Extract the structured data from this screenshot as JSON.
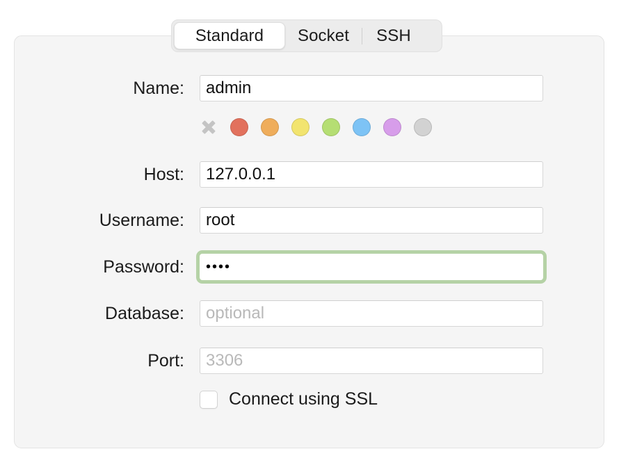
{
  "tabs": [
    {
      "id": "standard",
      "label": "Standard",
      "selected": true
    },
    {
      "id": "socket",
      "label": "Socket",
      "selected": false
    },
    {
      "id": "ssh",
      "label": "SSH",
      "selected": false
    }
  ],
  "form": {
    "name": {
      "label": "Name:",
      "value": "admin",
      "placeholder": ""
    },
    "host": {
      "label": "Host:",
      "value": "127.0.0.1",
      "placeholder": ""
    },
    "username": {
      "label": "Username:",
      "value": "root",
      "placeholder": ""
    },
    "password": {
      "label": "Password:",
      "value": "••••",
      "masked_character_count": 4,
      "placeholder": "",
      "focused": true
    },
    "database": {
      "label": "Database:",
      "value": "",
      "placeholder": "optional"
    },
    "port": {
      "label": "Port:",
      "value": "",
      "placeholder": "3306"
    }
  },
  "color_swatches": {
    "clear_icon": "x-icon",
    "items": [
      {
        "name": "red",
        "hex": "#e2715d"
      },
      {
        "name": "orange",
        "hex": "#efad5b"
      },
      {
        "name": "yellow",
        "hex": "#f2e46f"
      },
      {
        "name": "green",
        "hex": "#b5de73"
      },
      {
        "name": "blue",
        "hex": "#7dc3f5"
      },
      {
        "name": "purple",
        "hex": "#d79dea"
      },
      {
        "name": "gray",
        "hex": "#d2d2d2"
      }
    ]
  },
  "ssl": {
    "label": "Connect using SSL",
    "checked": false
  },
  "colors": {
    "panel_background": "#f5f5f5",
    "panel_border": "#e3e3e3",
    "tabbar_background": "#ececec",
    "selected_tab_background": "#ffffff",
    "focus_ring": "#b5d2a6",
    "input_background": "#ffffff",
    "input_border": "#d6d6d6",
    "placeholder_text": "#b9b9b9",
    "label_text": "#1b1b1b"
  }
}
